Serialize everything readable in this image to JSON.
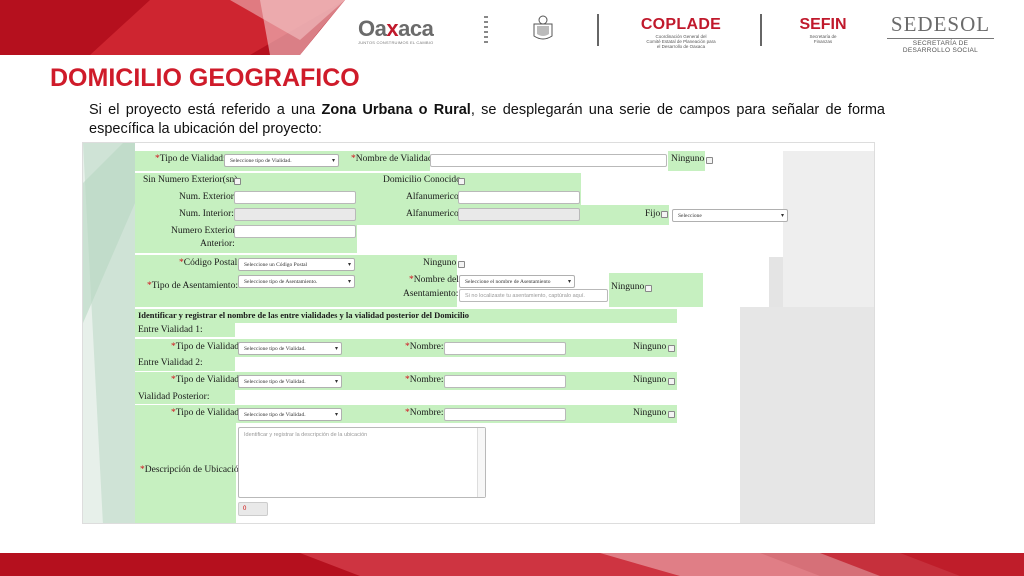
{
  "colors": {
    "brand_red": "#c0192c",
    "title_red": "#cf1b2a",
    "form_green": "#c6f0c0"
  },
  "header": {
    "logos": {
      "oaxaca": {
        "word_left": "Oa",
        "word_x": "x",
        "word_right": "aca",
        "tagline": "JUNTOS CONSTRUIMOS EL CAMBIO"
      },
      "seal": {
        "caption": "Gobierno del Estado de Oaxaca 2016-2022"
      },
      "coplade": {
        "name": "COPLADE",
        "sub1": "Coordinación General del",
        "sub2": "Comité Estatal de Planeación para",
        "sub3": "el Desarrollo de Oaxaca"
      },
      "sefin": {
        "name": "SEFIN",
        "sub1": "Secretaría de",
        "sub2": "Finanzas"
      },
      "sedesol": {
        "name": "SEDESOL",
        "sub1": "SECRETARÍA DE",
        "sub2": "DESARROLLO SOCIAL"
      }
    }
  },
  "slide": {
    "title": "DOMICILIO GEOGRAFICO",
    "intro_1": "Si el proyecto está referido a una ",
    "intro_bold": "Zona Urbana o Rural",
    "intro_2": ", se desplegarán una serie de campos para señalar de forma específica la ubicación del proyecto:"
  },
  "form": {
    "tipo_vialidad_label": "Tipo de Vialidad:",
    "tipo_vialidad_select": "Seleccione tipo de Vialidad.",
    "nombre_vialidad_label": "Nombre de Vialidad",
    "ninguno": "Ninguno",
    "sin_numero_exterior": "Sin Numero Exterior(sn)",
    "domicilio_conocido": "Domicilio Conocido",
    "num_exterior": "Num. Exterior:",
    "num_interior": "Num. Interior:",
    "alfanumerico": "Alfanumerico",
    "fijo": "Fijo",
    "fijo_select": "Seleccione",
    "numero_exterior_anterior_1": "Numero Exterior",
    "numero_exterior_anterior_2": "Anterior:",
    "codigo_postal_label": "Código Postal:",
    "codigo_postal_select": "Seleccione un Código Postal",
    "tipo_asentamiento_label": "Tipo de Asentamiento:",
    "tipo_asentamiento_select": "Seleccione tipo de Asentamiento.",
    "nombre_asentamiento_label_1": "Nombre del",
    "nombre_asentamiento_label_2": "Asentamiento:",
    "nombre_asentamiento_select": "Seleccione el nombre de Asentamiento",
    "nombre_asentamiento_placeholder": "Si no localizaste tu asentamiento, captúralo aquí.",
    "entre_vialidades_heading": "Identificar y registrar el nombre de las entre vialidades y la vialidad posterior del Domicilio",
    "entre_vialidad_1": "Entre Vialidad 1:",
    "entre_vialidad_2": "Entre Vialidad 2:",
    "vialidad_posterior": "Vialidad Posterior:",
    "tipo_vialidad_short_select": "Seleccione tipo de Vialidad.",
    "nombre_label": "Nombre:",
    "descripcion_label": "Descripción de Ubicación",
    "descripcion_placeholder": "Identificar y registrar la descripción de la ubicación",
    "counter": "0"
  }
}
